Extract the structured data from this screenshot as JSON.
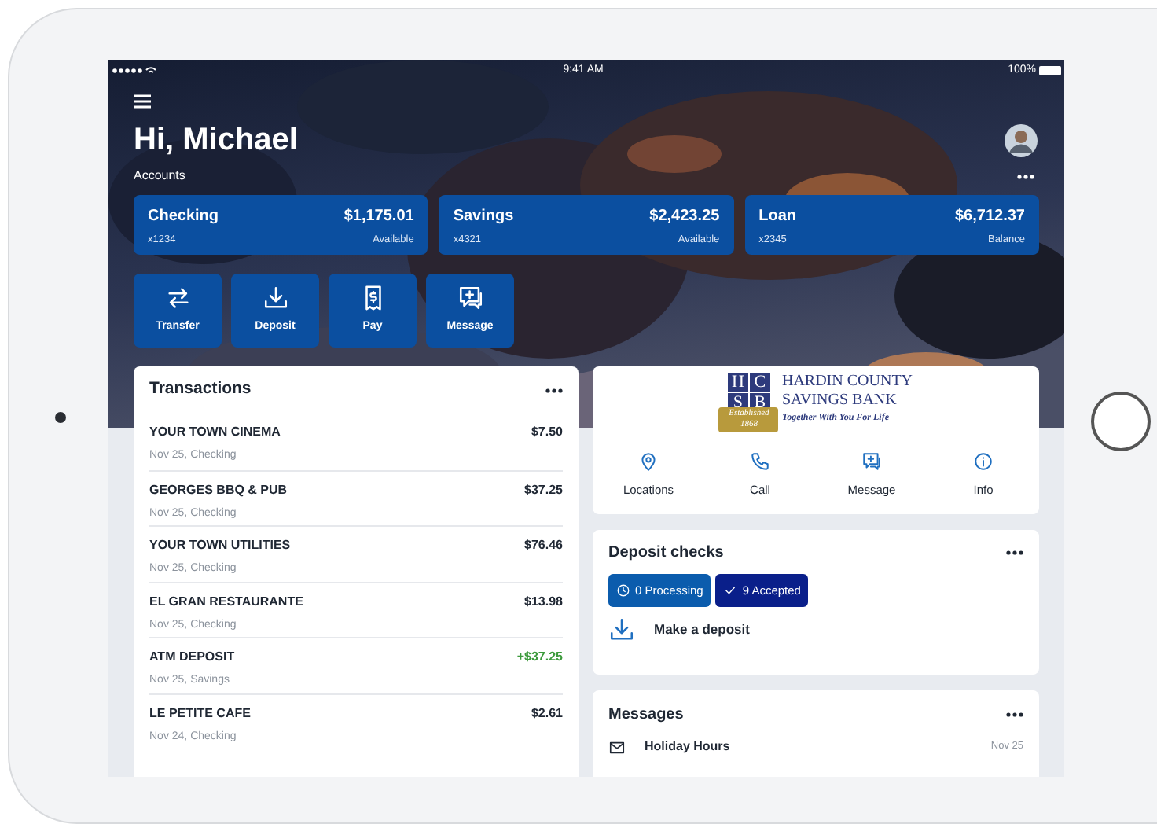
{
  "status_bar": {
    "time": "9:41 AM",
    "battery": "100%"
  },
  "greeting": "Hi, Michael",
  "accounts_label": "Accounts",
  "accounts": [
    {
      "name": "Checking",
      "number": "x1234",
      "balance": "$1,175.01",
      "balance_label": "Available"
    },
    {
      "name": "Savings",
      "number": "x4321",
      "balance": "$2,423.25",
      "balance_label": "Available"
    },
    {
      "name": "Loan",
      "number": "x2345",
      "balance": "$6,712.37",
      "balance_label": "Balance"
    }
  ],
  "actions": [
    {
      "label": "Transfer",
      "kind": "transfer"
    },
    {
      "label": "Deposit",
      "kind": "deposit"
    },
    {
      "label": "Pay",
      "kind": "pay"
    },
    {
      "label": "Message",
      "kind": "message"
    }
  ],
  "transactions": {
    "title": "Transactions",
    "items": [
      {
        "merchant": "YOUR TOWN CINEMA",
        "detail": "Nov 25, Checking",
        "amount": "$7.50",
        "kind": "debit"
      },
      {
        "merchant": "GEORGES BBQ & PUB",
        "detail": "Nov 25, Checking",
        "amount": "$37.25",
        "kind": "debit"
      },
      {
        "merchant": "YOUR TOWN UTILITIES",
        "detail": "Nov 25, Checking",
        "amount": "$76.46",
        "kind": "debit"
      },
      {
        "merchant": "EL GRAN RESTAURANTE",
        "detail": "Nov 25, Checking",
        "amount": "$13.98",
        "kind": "debit"
      },
      {
        "merchant": "ATM DEPOSIT",
        "detail": "Nov 25, Savings",
        "amount": "+$37.25",
        "kind": "credit"
      },
      {
        "merchant": "LE PETITE CAFE",
        "detail": "Nov 24, Checking",
        "amount": "$2.61",
        "kind": "debit"
      }
    ]
  },
  "bank": {
    "logo": {
      "letters": [
        "H",
        "C",
        "S",
        "B"
      ],
      "name_lines": [
        "HARDIN COUNTY",
        "SAVINGS BANK"
      ],
      "tagline": "Together With You For Life",
      "ribbon": [
        "Established",
        "1868"
      ]
    },
    "links": [
      {
        "label": "Locations",
        "kind": "location"
      },
      {
        "label": "Call",
        "kind": "call"
      },
      {
        "label": "Message",
        "kind": "message"
      },
      {
        "label": "Info",
        "kind": "info"
      }
    ]
  },
  "deposit_checks": {
    "title": "Deposit checks",
    "chips": [
      {
        "label": "0 Processing",
        "kind": "processing"
      },
      {
        "label": "9 Accepted",
        "kind": "accepted"
      }
    ],
    "action": "Make a deposit"
  },
  "messages": {
    "title": "Messages",
    "items": [
      {
        "subject": "Holiday Hours",
        "date": "Nov 25"
      }
    ]
  }
}
